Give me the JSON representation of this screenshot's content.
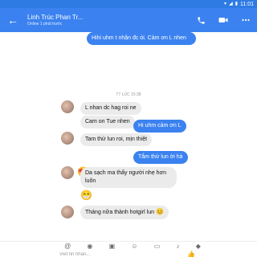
{
  "status_bar": {
    "time": "11:01"
  },
  "header": {
    "contact_name": "Linh Trúc Phan Tr...",
    "contact_status": "Online 1 phút trước"
  },
  "messages": {
    "m1": "Hihi uhm t nhận đc òi. Cảm ơn L nhen",
    "timestamp": "T7 LÚC 15:38",
    "m2": "L nhan dc hag roi ne",
    "m3": "Cam on Tue nhen",
    "m4": "Tam thử lun roi, mịn thiệt",
    "m5": "Hi uhm cảm ơn L",
    "m6": "Tắm thử lun ời hà",
    "m7": "Da sạch ma thấy người nhẹ hơn luôn",
    "m8": "Tháng nữa thành hotgirl lun"
  },
  "icons": {
    "back": "arrow-left-icon",
    "call": "phone-icon",
    "video": "video-camera-icon",
    "menu": "more-icon"
  },
  "composer": {
    "placeholder": "Viết tin nhắn..."
  },
  "colors": {
    "accent": "#3b82f0",
    "incoming_bubble": "#ebebeb"
  }
}
